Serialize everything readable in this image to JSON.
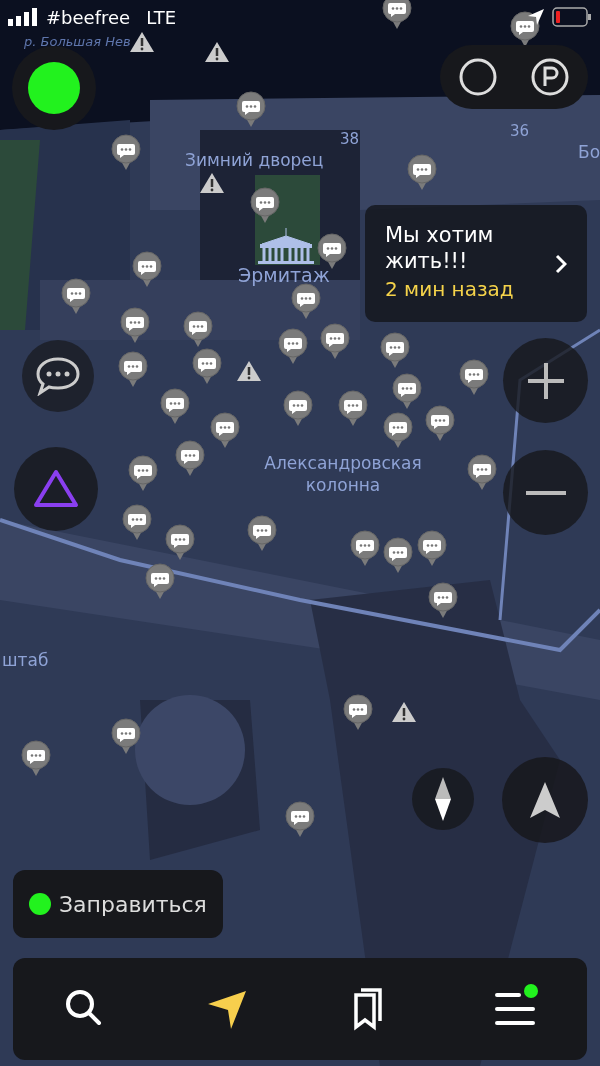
{
  "status_bar": {
    "carrier": "#beefree",
    "network": "LTE",
    "battery_low": true
  },
  "map_labels": [
    {
      "kind": "river",
      "text": "р. Большая Нев"
    },
    {
      "kind": "place",
      "text": "Зимний дворец"
    },
    {
      "kind": "number",
      "text": "38"
    },
    {
      "kind": "number",
      "text": "36"
    },
    {
      "kind": "place",
      "text": "Бо"
    },
    {
      "kind": "landmark",
      "text": "Эрмитаж"
    },
    {
      "kind": "place",
      "text": "Александровская колонна"
    },
    {
      "kind": "place",
      "text": "штаб"
    }
  ],
  "notification": {
    "message": "Мы хотим жить!!!",
    "time": "2 мин назад"
  },
  "refuel_button": {
    "label": "Заправиться"
  },
  "bottom_nav": [
    {
      "kind": "search",
      "selected": false,
      "badge": false
    },
    {
      "kind": "navigate",
      "selected": true,
      "badge": false
    },
    {
      "kind": "bookmarks",
      "selected": false,
      "badge": false
    },
    {
      "kind": "menu",
      "selected": false,
      "badge": true
    }
  ]
}
